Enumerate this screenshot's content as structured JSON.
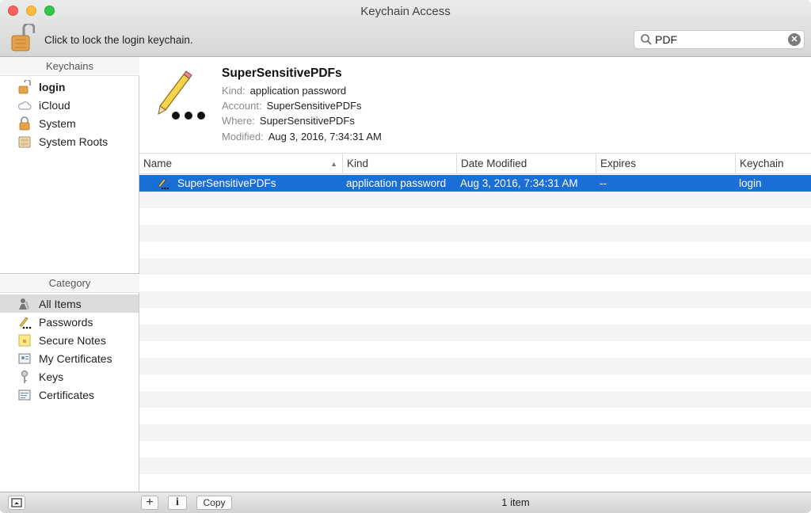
{
  "window": {
    "title": "Keychain Access"
  },
  "toolbar": {
    "lock_label": "Click to lock the login keychain.",
    "search_value": "PDF",
    "search_icon": "magnifier",
    "clear_icon": "x-circle"
  },
  "sidebar": {
    "keychains_header": "Keychains",
    "keychains": [
      {
        "label": "login",
        "icon": "open-lock",
        "bold": true
      },
      {
        "label": "iCloud",
        "icon": "cloud"
      },
      {
        "label": "System",
        "icon": "lock"
      },
      {
        "label": "System Roots",
        "icon": "cabinet"
      }
    ],
    "category_header": "Category",
    "categories": [
      {
        "label": "All Items",
        "icon": "people",
        "selected": true
      },
      {
        "label": "Passwords",
        "icon": "pencil-dots"
      },
      {
        "label": "Secure Notes",
        "icon": "note"
      },
      {
        "label": "My Certificates",
        "icon": "certificate-person"
      },
      {
        "label": "Keys",
        "icon": "key"
      },
      {
        "label": "Certificates",
        "icon": "certificate"
      }
    ]
  },
  "detail": {
    "name": "SuperSensitivePDFs",
    "kind_label": "Kind:",
    "kind_value": "application password",
    "account_label": "Account:",
    "account_value": "SuperSensitivePDFs",
    "where_label": "Where:",
    "where_value": "SuperSensitivePDFs",
    "modified_label": "Modified:",
    "modified_value": "Aug 3, 2016, 7:34:31 AM"
  },
  "table": {
    "columns": [
      "Name",
      "Kind",
      "Date Modified",
      "Expires",
      "Keychain"
    ],
    "rows": [
      {
        "name": "SuperSensitivePDFs",
        "kind": "application password",
        "date": "Aug 3, 2016, 7:34:31 AM",
        "expires": "--",
        "keychain": "login"
      }
    ]
  },
  "bottombar": {
    "add_label": "+",
    "info_label": "i",
    "copy_label": "Copy",
    "status": "1 item"
  },
  "colors": {
    "selection": "#1b6ed5",
    "accent": "#1b6ed5"
  }
}
